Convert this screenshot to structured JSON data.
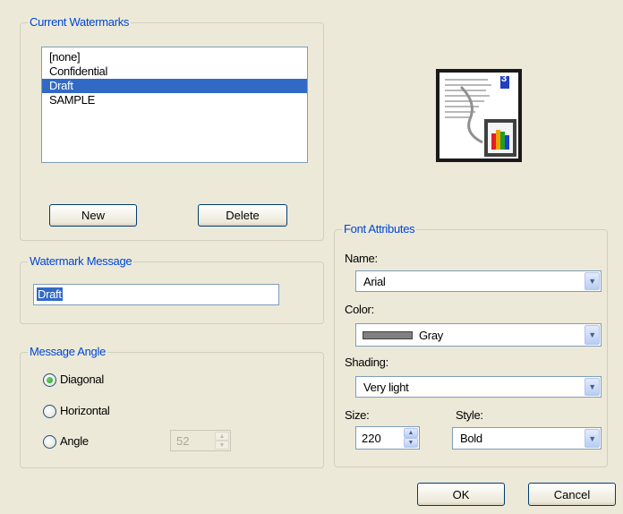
{
  "current_watermarks": {
    "title": "Current Watermarks",
    "items": [
      "[none]",
      "Confidential",
      "Draft",
      "SAMPLE"
    ],
    "selected": "Draft",
    "new_label": "New",
    "delete_label": "Delete"
  },
  "watermark_message": {
    "title": "Watermark Message",
    "value": "Draft"
  },
  "message_angle": {
    "title": "Message Angle",
    "options": [
      "Diagonal",
      "Horizontal",
      "Angle"
    ],
    "selected": "Diagonal",
    "angle_value": "52"
  },
  "preview": {
    "page_number": "3"
  },
  "font_attributes": {
    "title": "Font Attributes",
    "name_label": "Name:",
    "name_value": "Arial",
    "color_label": "Color:",
    "color_value": "Gray",
    "color_swatch": "#808080",
    "shading_label": "Shading:",
    "shading_value": "Very light",
    "size_label": "Size:",
    "size_value": "220",
    "style_label": "Style:",
    "style_value": "Bold"
  },
  "dialog_buttons": {
    "ok_label": "OK",
    "cancel_label": "Cancel"
  },
  "colors": {
    "group_title": "#0046d5",
    "selection": "#316ac5",
    "dialog_bg": "#ece9d8"
  }
}
